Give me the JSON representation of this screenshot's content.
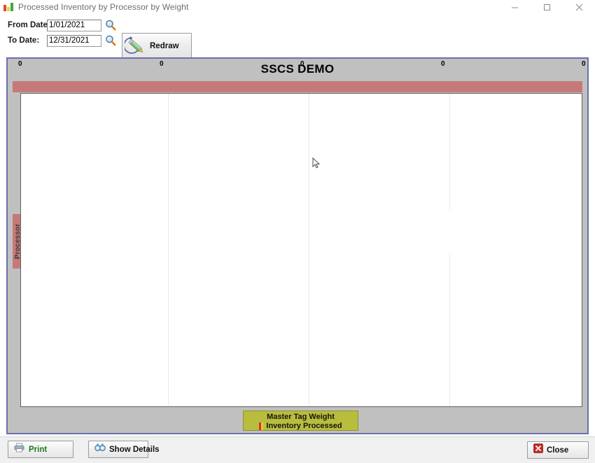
{
  "window": {
    "title": "Processed Inventory by Processor by Weight",
    "app_icon": "bar-chart-icon",
    "controls": {
      "minimize": "Minimize",
      "maximize": "Maximize",
      "close": "Close"
    }
  },
  "toolbar": {
    "from_date_label": "From Date:",
    "from_date_value": "1/01/2021",
    "to_date_label": "To Date:",
    "to_date_value": "12/31/2021",
    "lookup_icon": "magnifier-icon",
    "redraw_label": "Redraw",
    "redraw_icon": "pencil-refresh-icon"
  },
  "chart_data": {
    "type": "bar",
    "title": "SSCS DEMO",
    "xlabel": "",
    "ylabel": "Processor",
    "categories": [],
    "values": [],
    "series": [
      {
        "name": "Inventory Processed",
        "values": []
      }
    ],
    "xticks": [
      "0",
      "0",
      "0",
      "0",
      "0"
    ],
    "yticks": [],
    "xlim": [
      0,
      0
    ],
    "grid": true,
    "legend_position": "bottom",
    "legend_title": "Master Tag Weight",
    "legend_entries": [
      {
        "label": "Inventory Processed",
        "color": "#d8322a"
      }
    ],
    "note": "empty chart - no data plotted for selected date range"
  },
  "chart": {
    "title": "SSCS DEMO",
    "axis_title": "Processor",
    "x_tick_labels": [
      "0",
      "0",
      "0",
      "0",
      "0"
    ],
    "legend_title": "Master Tag Weight",
    "legend_series": "Inventory Processed"
  },
  "colors": {
    "axis_band": "#c57a79",
    "legend_box": "#b9bd3e",
    "frame_border": "#6b6fb0",
    "chart_background": "#c0c0c0",
    "plot_background": "#ffffff",
    "gridline": "#e9e9e9"
  },
  "footer": {
    "print_label": "Print",
    "print_icon": "printer-icon",
    "details_label": "Show Details",
    "details_icon": "binoculars-icon",
    "close_label": "Close",
    "close_icon": "red-x-icon"
  }
}
